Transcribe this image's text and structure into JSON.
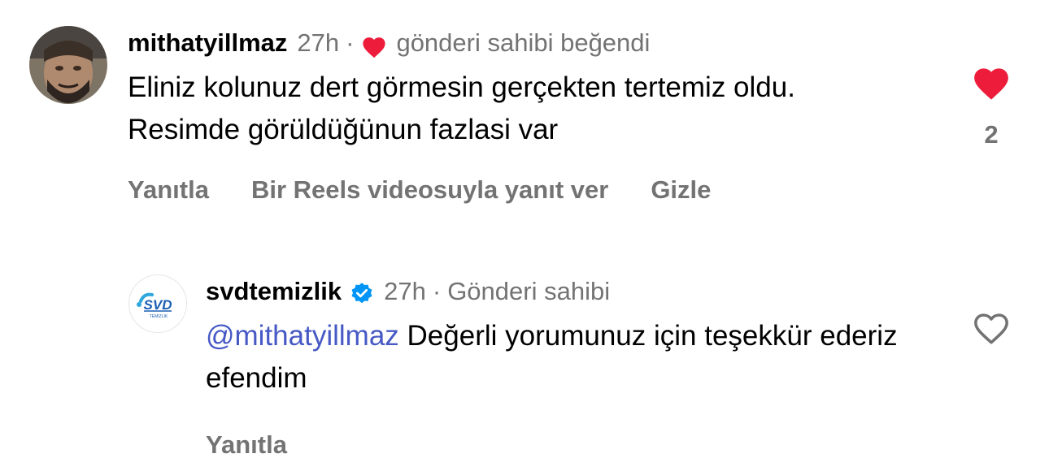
{
  "comments": [
    {
      "username": "mithatyillmaz",
      "time": "27h",
      "separator": "·",
      "owner_note": "gönderi sahibi beğendi",
      "text": "Eliniz kolunuz dert görmesin gerçekten tertemiz oldu. Resimde görüldüğünun fazlasi var",
      "like_count": "2",
      "liked": true,
      "actions": {
        "reply": "Yanıtla",
        "reels_reply": "Bir Reels videosuyla yanıt ver",
        "hide": "Gizle"
      }
    },
    {
      "username": "svdtemizlik",
      "verified": true,
      "time": "27h",
      "separator": "·",
      "owner_note": "Gönderi sahibi",
      "mention": "@mithatyillmaz",
      "text": "Değerli yorumunuz için teşekkür ederiz efendim",
      "liked": false,
      "actions": {
        "reply": "Yanıtla"
      },
      "avatar_logo": {
        "letters": "SVD",
        "subtitle": "TEMİZLİK"
      }
    }
  ],
  "colors": {
    "accent_heart": "#ed1c3a",
    "mention": "#4659c5",
    "muted": "#737373",
    "verified": "#0095f6"
  },
  "icons": {
    "liked_heart": "heart-filled-icon",
    "unliked_heart": "heart-outline-icon",
    "verified_badge": "verified-badge-icon"
  }
}
